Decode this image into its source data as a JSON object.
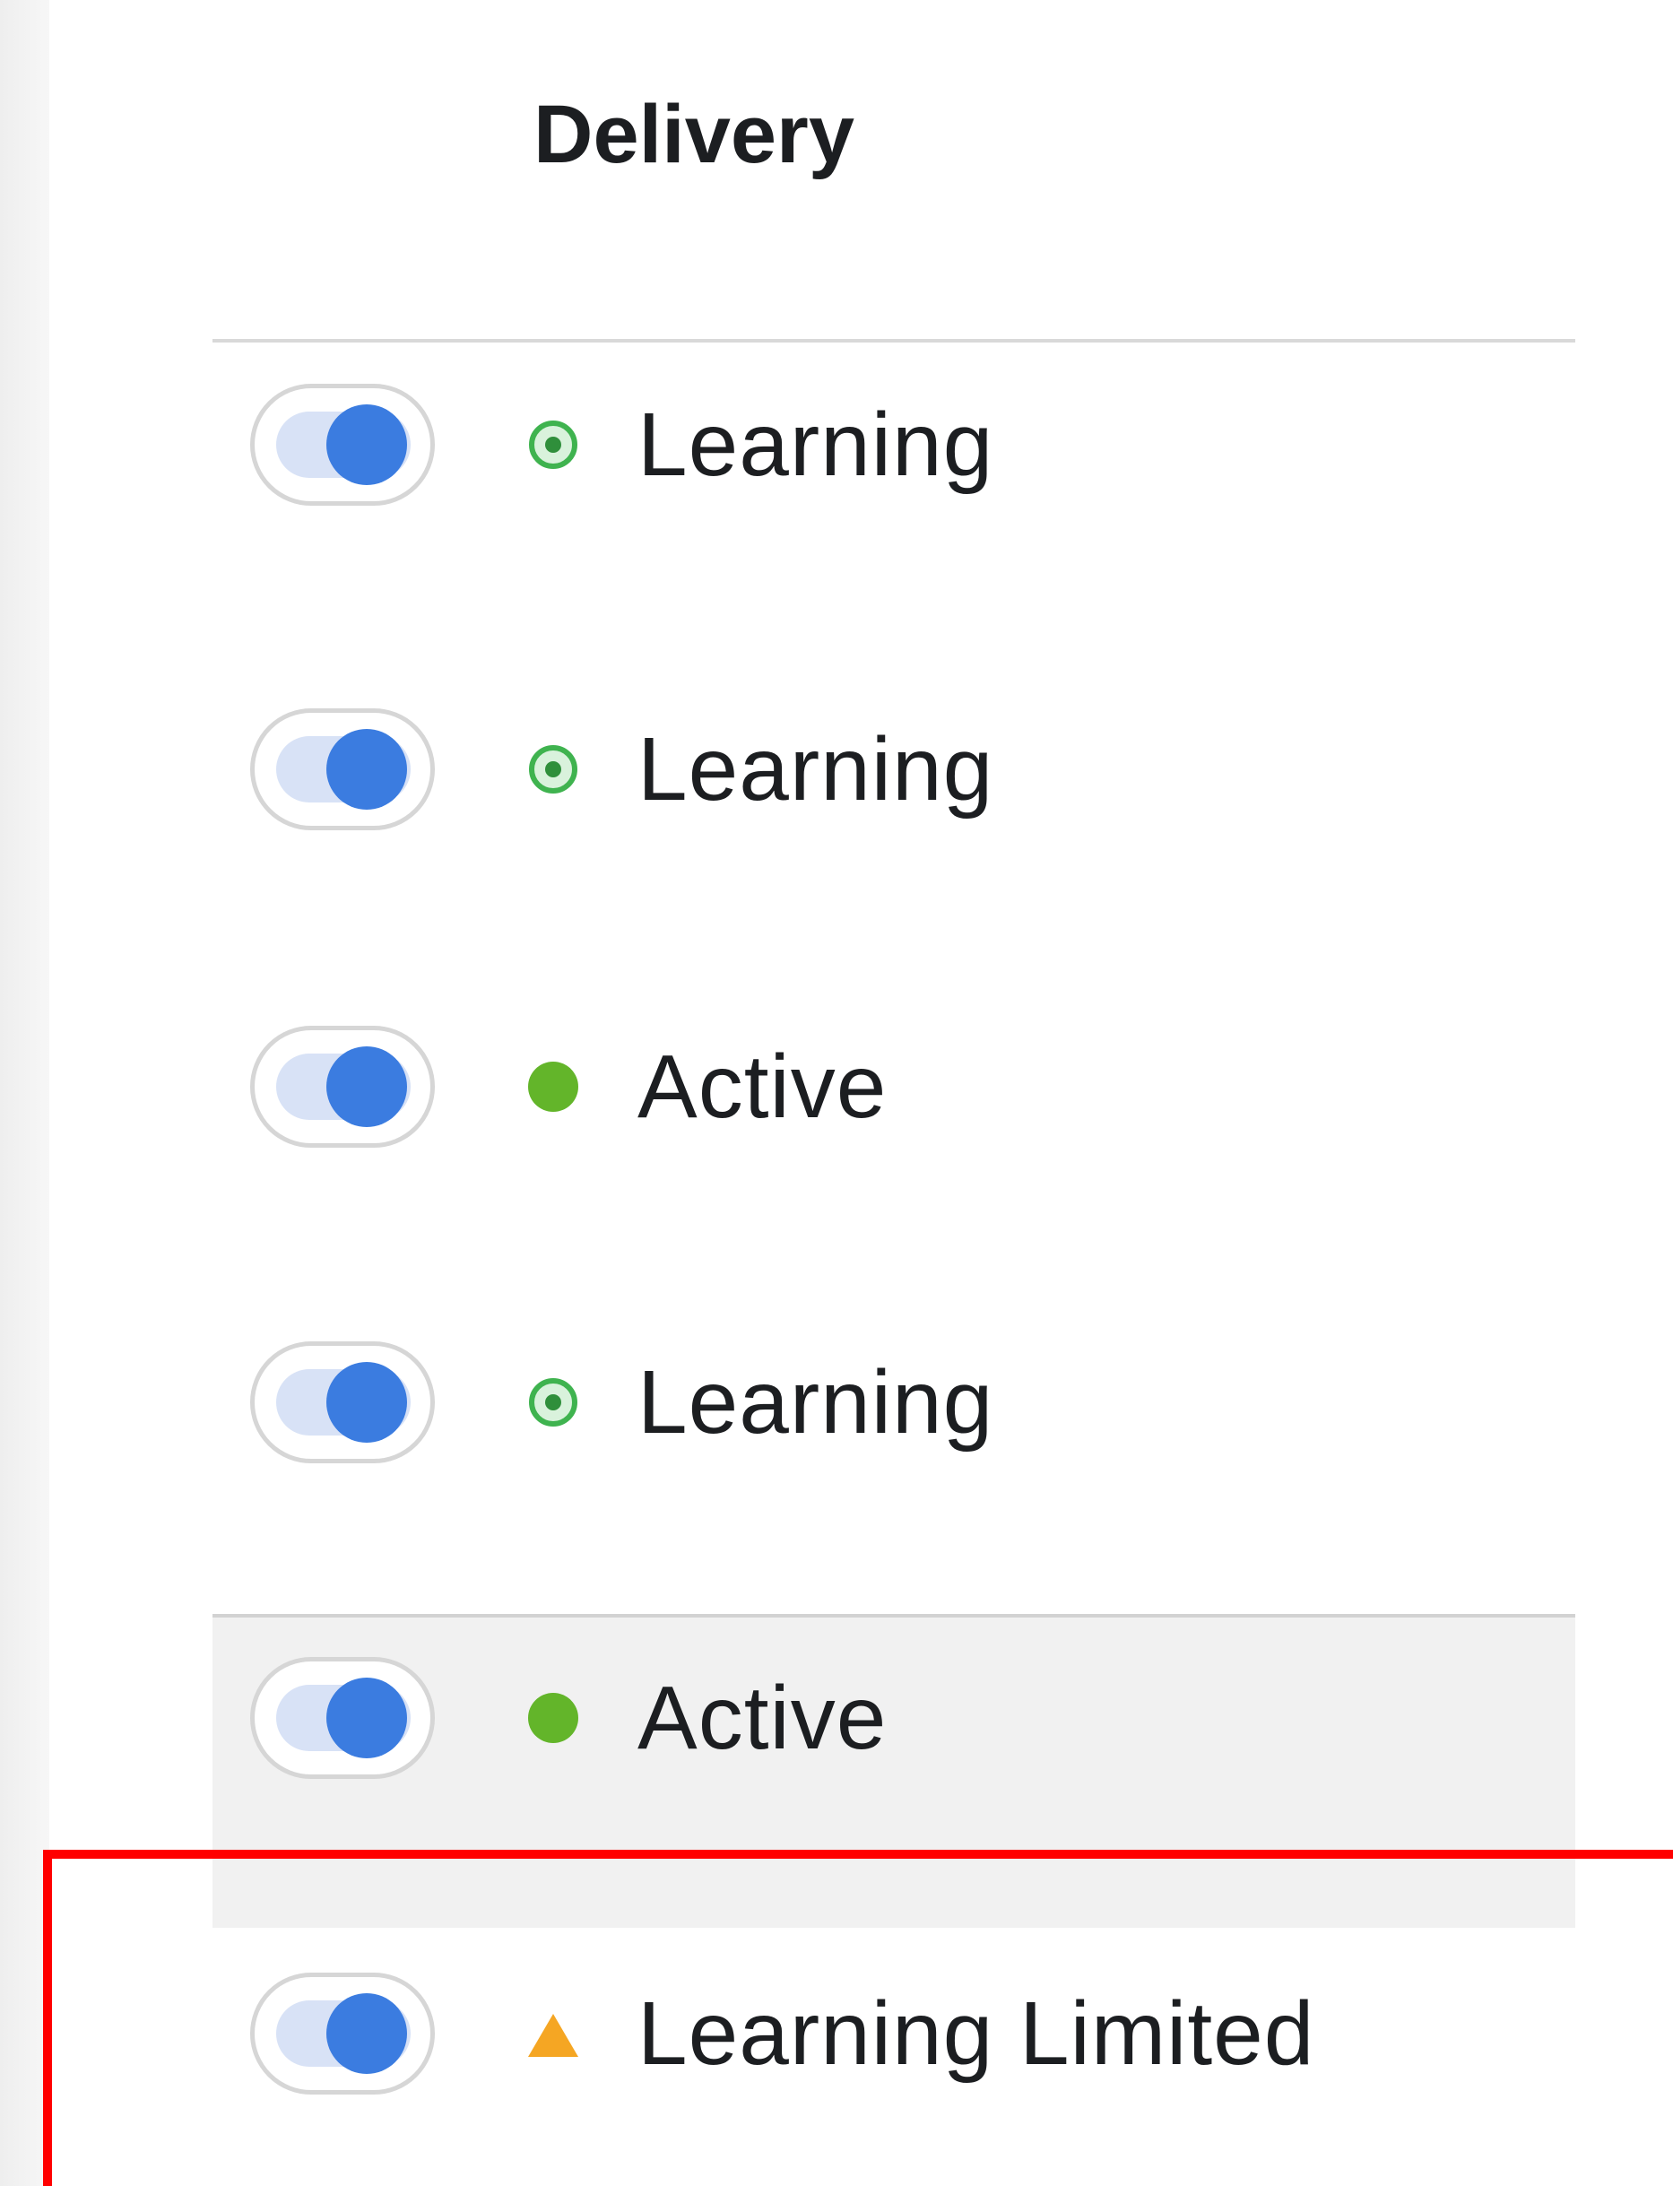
{
  "header": {
    "title": "Delivery"
  },
  "rows": [
    {
      "status": "Learning",
      "icon": "learning-status-icon",
      "toggle_on": true
    },
    {
      "status": "Learning",
      "icon": "learning-status-icon",
      "toggle_on": true
    },
    {
      "status": "Active",
      "icon": "active-dot-icon",
      "toggle_on": true
    },
    {
      "status": "Learning",
      "icon": "learning-status-icon",
      "toggle_on": true
    },
    {
      "status": "Active",
      "icon": "active-dot-icon",
      "toggle_on": true
    },
    {
      "status": "Learning Limited",
      "icon": "warning-triangle-icon",
      "toggle_on": true
    }
  ],
  "colors": {
    "toggle_knob": "#3b7ce0",
    "toggle_track": "#d8e2f6",
    "learning_green": "#3fb34f",
    "active_green": "#63b52a",
    "warning_orange": "#f5a623",
    "callout_red": "#ff0000"
  }
}
